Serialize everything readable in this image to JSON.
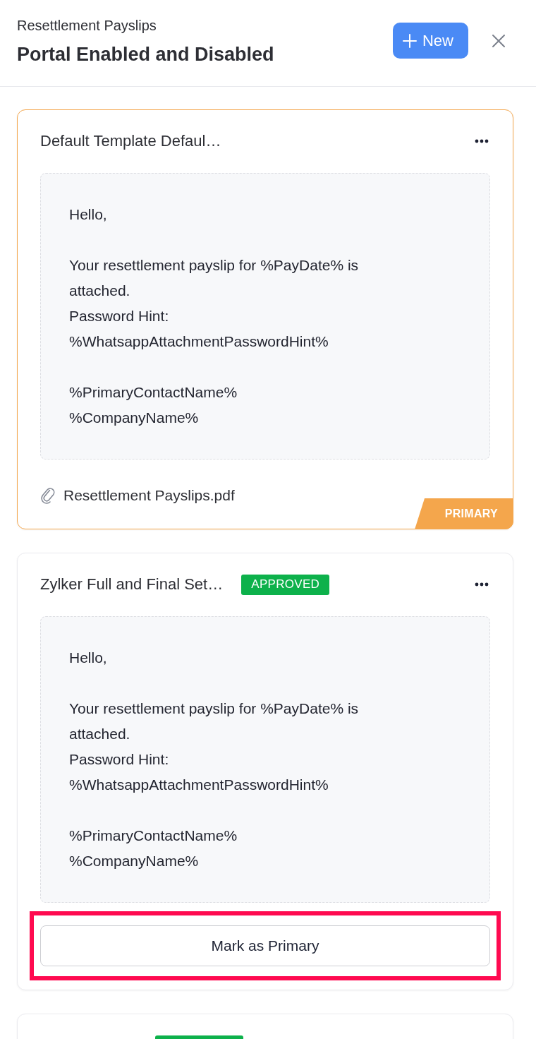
{
  "header": {
    "subtitle": "Resettlement Payslips",
    "title": "Portal Enabled and Disabled",
    "new_button": {
      "label": "New"
    }
  },
  "templates": [
    {
      "title": "Default Template Defaul…",
      "primary": true,
      "body": [
        [
          "Hello,"
        ],
        [
          "Your resettlement payslip for %PayDate% is attached.",
          "Password Hint:",
          "%WhatsappAttachmentPasswordHint%"
        ],
        [
          "%PrimaryContactName%",
          "%CompanyName%"
        ]
      ],
      "attachment": "Resettlement Payslips.pdf",
      "ribbon": "PRIMARY"
    },
    {
      "title": "Zylker Full and Final Set…",
      "primary": false,
      "badge": {
        "kind": "approved",
        "label": "APPROVED"
      },
      "body": [
        [
          "Hello,"
        ],
        [
          "Your resettlement payslip for %PayDate% is attached.",
          "Password Hint:",
          "%WhatsappAttachmentPasswordHint%"
        ],
        [
          "%PrimaryContactName%",
          "%CompanyName%"
        ]
      ],
      "action": {
        "label": "Mark as Primary",
        "highlighted": true
      }
    },
    {
      "primary": false,
      "badge": {
        "kind": "approved"
      }
    }
  ]
}
